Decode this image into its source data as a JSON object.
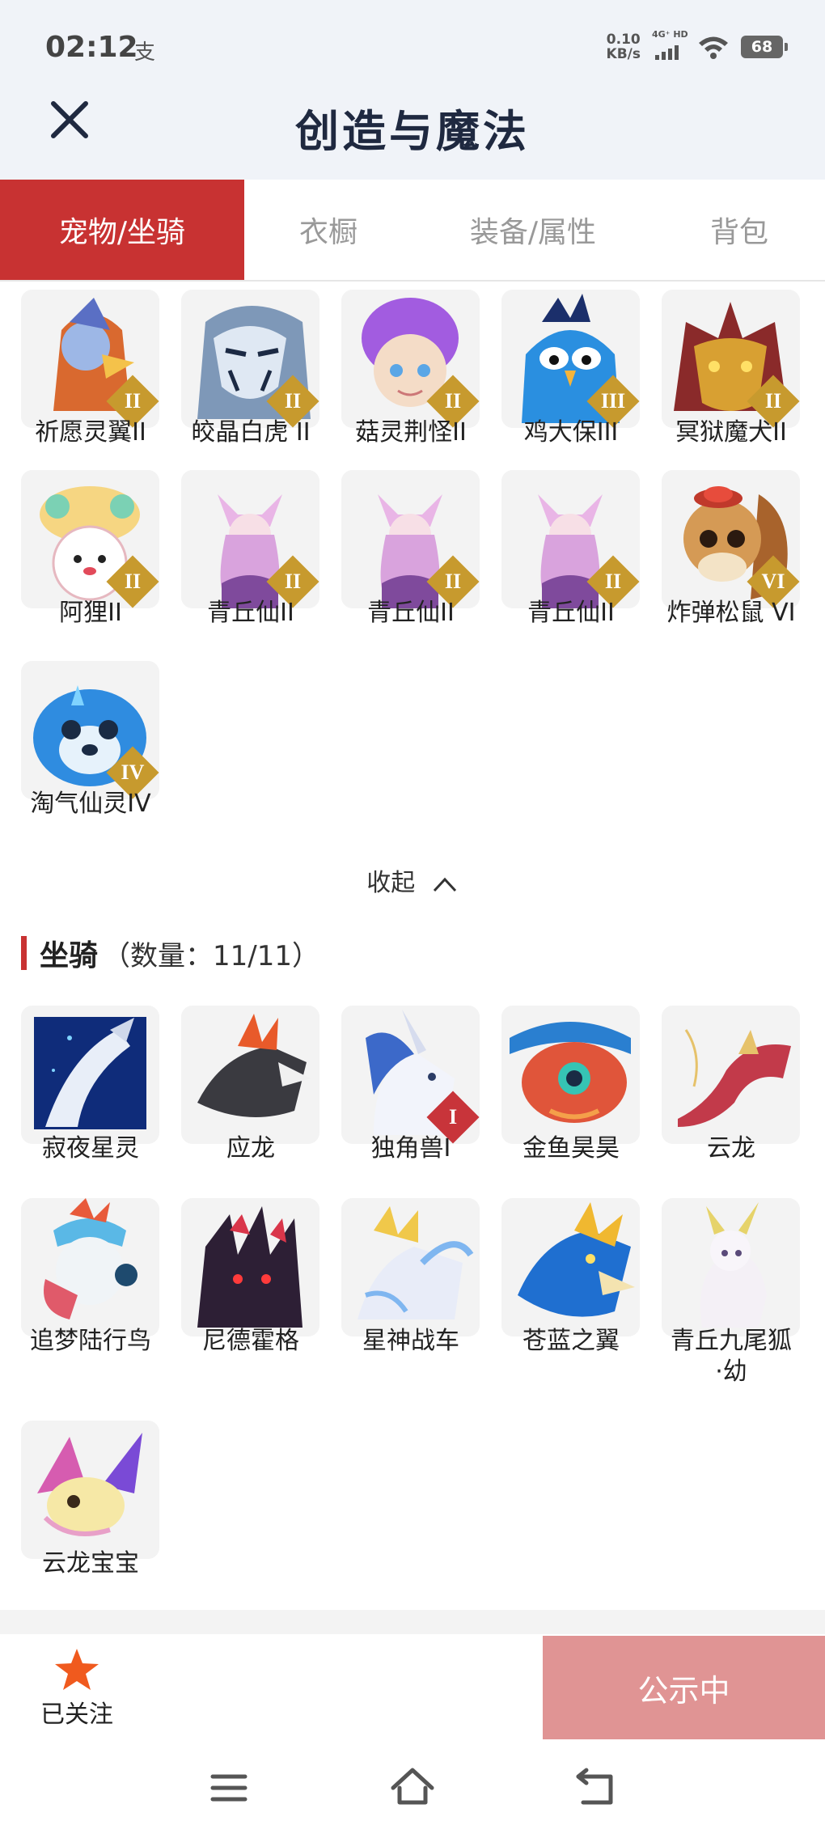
{
  "status_bar": {
    "time": "02:12",
    "alipay_icon_char": "支",
    "net_speed_value": "0.10",
    "net_speed_unit": "KB/s",
    "network_label": "4G⁺ HD",
    "battery_level": "68"
  },
  "header": {
    "title": "创造与魔法",
    "close_icon": "close-icon"
  },
  "tabs": [
    {
      "label": "宠物/坐骑",
      "active": true
    },
    {
      "label": "衣橱",
      "active": false
    },
    {
      "label": "装备/属性",
      "active": false
    },
    {
      "label": "背包",
      "active": false
    }
  ],
  "pets": [
    {
      "name": "祈愿灵翼II",
      "badge": "II"
    },
    {
      "name": "皎晶白虎 II",
      "badge": "II"
    },
    {
      "name": "菇灵荆怪II",
      "badge": "II"
    },
    {
      "name": "鸡大保III",
      "badge": "III"
    },
    {
      "name": "冥狱魔犬II",
      "badge": "II"
    },
    {
      "name": "阿狸II",
      "badge": "II"
    },
    {
      "name": "青丘仙II",
      "badge": "II"
    },
    {
      "name": "青丘仙II",
      "badge": "II"
    },
    {
      "name": "青丘仙II",
      "badge": "II"
    },
    {
      "name": "炸弹松鼠 VI",
      "badge": "VI"
    },
    {
      "name": "淘气仙灵IV",
      "badge": "IV"
    }
  ],
  "collapse_label": "收起",
  "mounts_section": {
    "title": "坐骑",
    "count": "（数量：11/11）"
  },
  "mounts": [
    {
      "name": "寂夜星灵",
      "badge": ""
    },
    {
      "name": "应龙",
      "badge": ""
    },
    {
      "name": "独角兽I",
      "badge": "I"
    },
    {
      "name": "金鱼昊昊",
      "badge": ""
    },
    {
      "name": "云龙",
      "badge": ""
    },
    {
      "name": "追梦陆行鸟",
      "badge": ""
    },
    {
      "name": "尼德霍格",
      "badge": ""
    },
    {
      "name": "星神战车",
      "badge": ""
    },
    {
      "name": "苍蓝之翼",
      "badge": ""
    },
    {
      "name": "青丘九尾狐\n·幼",
      "badge": ""
    },
    {
      "name": "云龙宝宝",
      "badge": ""
    }
  ],
  "bottom": {
    "follow_label": "已关注",
    "follow_icon": "star-icon",
    "status_button": "公示中"
  },
  "colors": {
    "accent": "#c83232",
    "badge_gold": "#c79a2e",
    "publicity_bg": "#e09494",
    "star": "#f05a1e"
  }
}
